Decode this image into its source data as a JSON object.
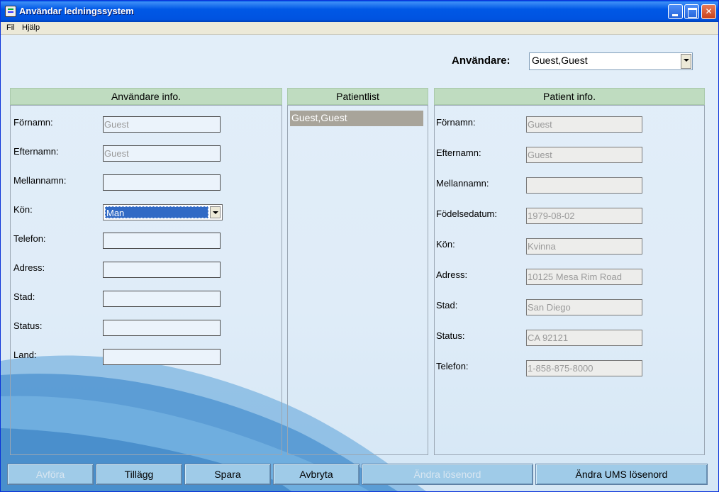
{
  "window": {
    "title": "Användar ledningssystem"
  },
  "menu": {
    "items": [
      "Fil",
      "Hjälp"
    ]
  },
  "user_selector": {
    "label": "Användare:",
    "value": "Guest,Guest"
  },
  "user_info": {
    "header": "Användare info.",
    "fields": [
      {
        "label": "Förnamn:",
        "value": "Guest"
      },
      {
        "label": "Efternamn:",
        "value": "Guest"
      },
      {
        "label": "Mellannamn:",
        "value": ""
      },
      {
        "label": "Kön:",
        "value": "Man"
      },
      {
        "label": "Telefon:",
        "value": ""
      },
      {
        "label": "Adress:",
        "value": ""
      },
      {
        "label": "Stad:",
        "value": ""
      },
      {
        "label": "Status:",
        "value": ""
      },
      {
        "label": "Land:",
        "value": ""
      }
    ]
  },
  "patient_list": {
    "header": "Patientlist",
    "items": [
      "Guest,Guest"
    ]
  },
  "patient_info": {
    "header": "Patient info.",
    "fields": [
      {
        "label": "Förnamn:",
        "value": "Guest"
      },
      {
        "label": "Efternamn:",
        "value": "Guest"
      },
      {
        "label": "Mellannamn:",
        "value": ""
      },
      {
        "label": "Födelsedatum:",
        "value": "1979-08-02"
      },
      {
        "label": "Kön:",
        "value": "Kvinna"
      },
      {
        "label": "Adress:",
        "value": "10125 Mesa Rim Road"
      },
      {
        "label": "Stad:",
        "value": "San Diego"
      },
      {
        "label": "Status:",
        "value": "CA 92121"
      },
      {
        "label": "Telefon:",
        "value": "1-858-875-8000"
      }
    ]
  },
  "buttons": {
    "remove": "Avföra",
    "add": "Tillägg",
    "save": "Spara",
    "cancel": "Avbryta",
    "change_password": "Ändra lösenord",
    "change_ums_password": "Ändra UMS lösenord"
  },
  "colors": {
    "titlebar": "#0058e6",
    "panel_header": "#bfdcc0",
    "button": "#9fcbe8",
    "selection": "#316ac5"
  }
}
